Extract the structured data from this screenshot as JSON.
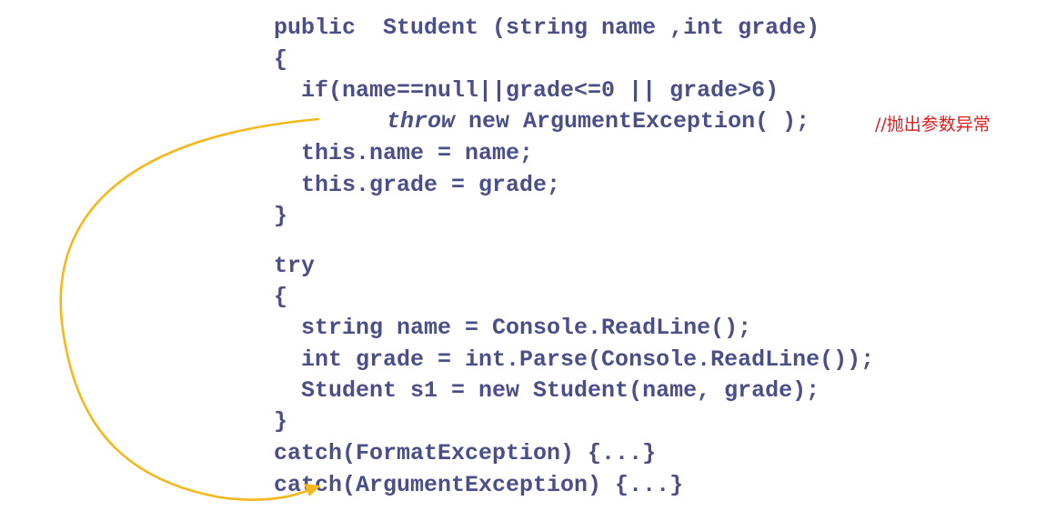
{
  "code": {
    "constructor": [
      "public  Student (string name ,int grade)",
      "{",
      "  if(name==null||grade<=0 || grade>6)",
      "throw",
      " new ArgumentException( );",
      "  this.name = name;",
      "  this.grade = grade;",
      "}"
    ],
    "comment": "//抛出参数异常",
    "try_block": [
      "try",
      "{",
      "  string name = Console.ReadLine();",
      "  int grade = int.Parse(Console.ReadLine());",
      "  Student s1 = new Student(name, grade);",
      "}",
      "catch(FormatException) {...}",
      "catch(ArgumentException) {...}"
    ]
  },
  "colors": {
    "code_text": "#4b4f88",
    "comment_text": "#e21b1b",
    "arrow": "#f5b81c"
  },
  "icons": {
    "flow_arrow": "curved-arrow-icon"
  }
}
